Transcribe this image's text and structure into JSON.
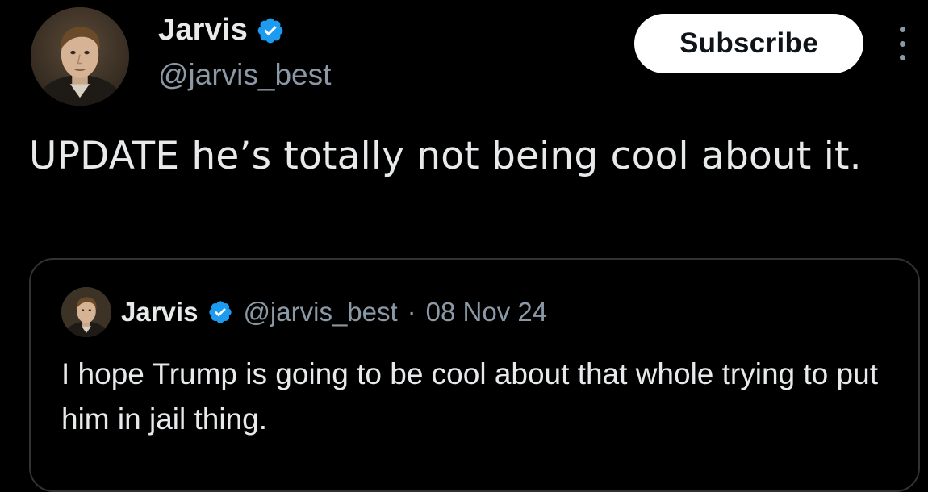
{
  "tweet": {
    "author": {
      "display_name": "Jarvis",
      "handle": "@jarvis_best",
      "avatar_icon": "portrait-avatar",
      "verified": true,
      "verified_icon": "verified-badge-icon"
    },
    "subscribe_label": "Subscribe",
    "more_icon": "more-options-icon",
    "text": "UPDATE he’s totally not being cool about it.",
    "quote": {
      "display_name": "Jarvis",
      "handle": "@jarvis_best",
      "separator": "·",
      "date": "08 Nov 24",
      "verified": true,
      "text": "I hope Trump is going to be cool about that whole trying to put him in jail thing."
    }
  },
  "colors": {
    "background": "#000000",
    "text_primary": "#e7e9ea",
    "text_secondary": "#8b98a5",
    "verified_blue": "#1d9bf0",
    "button_bg": "#ffffff",
    "button_text": "#0f1419",
    "border": "#2f3336"
  }
}
